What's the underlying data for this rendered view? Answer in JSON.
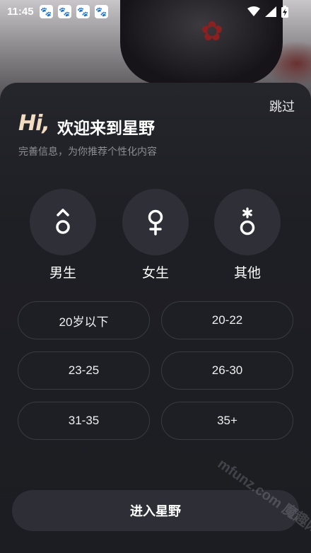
{
  "status_bar": {
    "time": "11:45",
    "notification_icons": [
      "baidu-paw-icon",
      "baidu-paw-icon",
      "baidu-paw-icon",
      "baidu-paw-icon"
    ],
    "system_icons": [
      "wifi-icon",
      "signal-icon",
      "battery-charging-icon"
    ]
  },
  "header": {
    "skip": "跳过",
    "hi": "Hi,",
    "title": "欢迎来到星野",
    "subtitle": "完善信息，为你推荐个性化内容"
  },
  "gender": {
    "options": [
      {
        "label": "男生",
        "icon": "male-symbol-icon"
      },
      {
        "label": "女生",
        "icon": "female-symbol-icon"
      },
      {
        "label": "其他",
        "icon": "other-gender-icon"
      }
    ]
  },
  "age": {
    "options": [
      "20岁以下",
      "20-22",
      "23-25",
      "26-30",
      "31-35",
      "35+"
    ]
  },
  "footer": {
    "enter": "进入星野"
  },
  "watermark": "mfunz.com 魔趣网",
  "colors": {
    "background": "#1b1c21",
    "card": "#25262c",
    "chip_border": "#3a3b42",
    "hi_accent": "#f2dcc2",
    "subtitle": "#8d8e94"
  }
}
